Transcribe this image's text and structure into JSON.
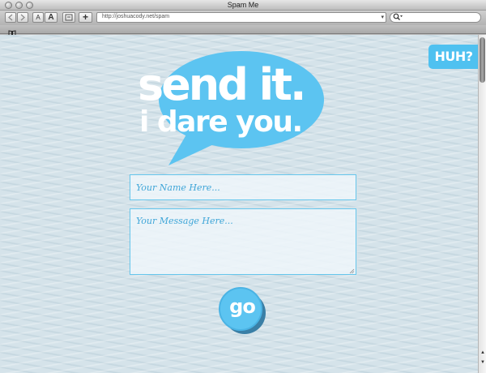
{
  "window": {
    "title": "Spam Me"
  },
  "toolbar": {
    "text_smaller_label": "A",
    "text_bigger_label": "A",
    "add_bookmark_label": "+",
    "url": "http://joshuacody.net/spam",
    "search_placeholder": ""
  },
  "page": {
    "huh_label": "HUH?",
    "headline_line1": "send it.",
    "headline_line2": "i dare you.",
    "name_placeholder": "Your Name Here...",
    "message_placeholder": "Your Message Here...",
    "go_label": "go"
  },
  "colors": {
    "accent": "#5cc4f1",
    "page_background": "#d5e3ea",
    "input_border": "#66c6ec",
    "placeholder_text": "#3fa6d8"
  },
  "icons": {
    "window_controls": [
      "close-icon",
      "minimize-icon",
      "zoom-icon"
    ],
    "nav": [
      "back-arrow-icon",
      "forward-arrow-icon"
    ],
    "other": [
      "snapback-icon",
      "magnifier-icon",
      "book-icon",
      "resize-grip-icon",
      "scroll-up-arrow-icon",
      "scroll-down-arrow-icon"
    ]
  }
}
